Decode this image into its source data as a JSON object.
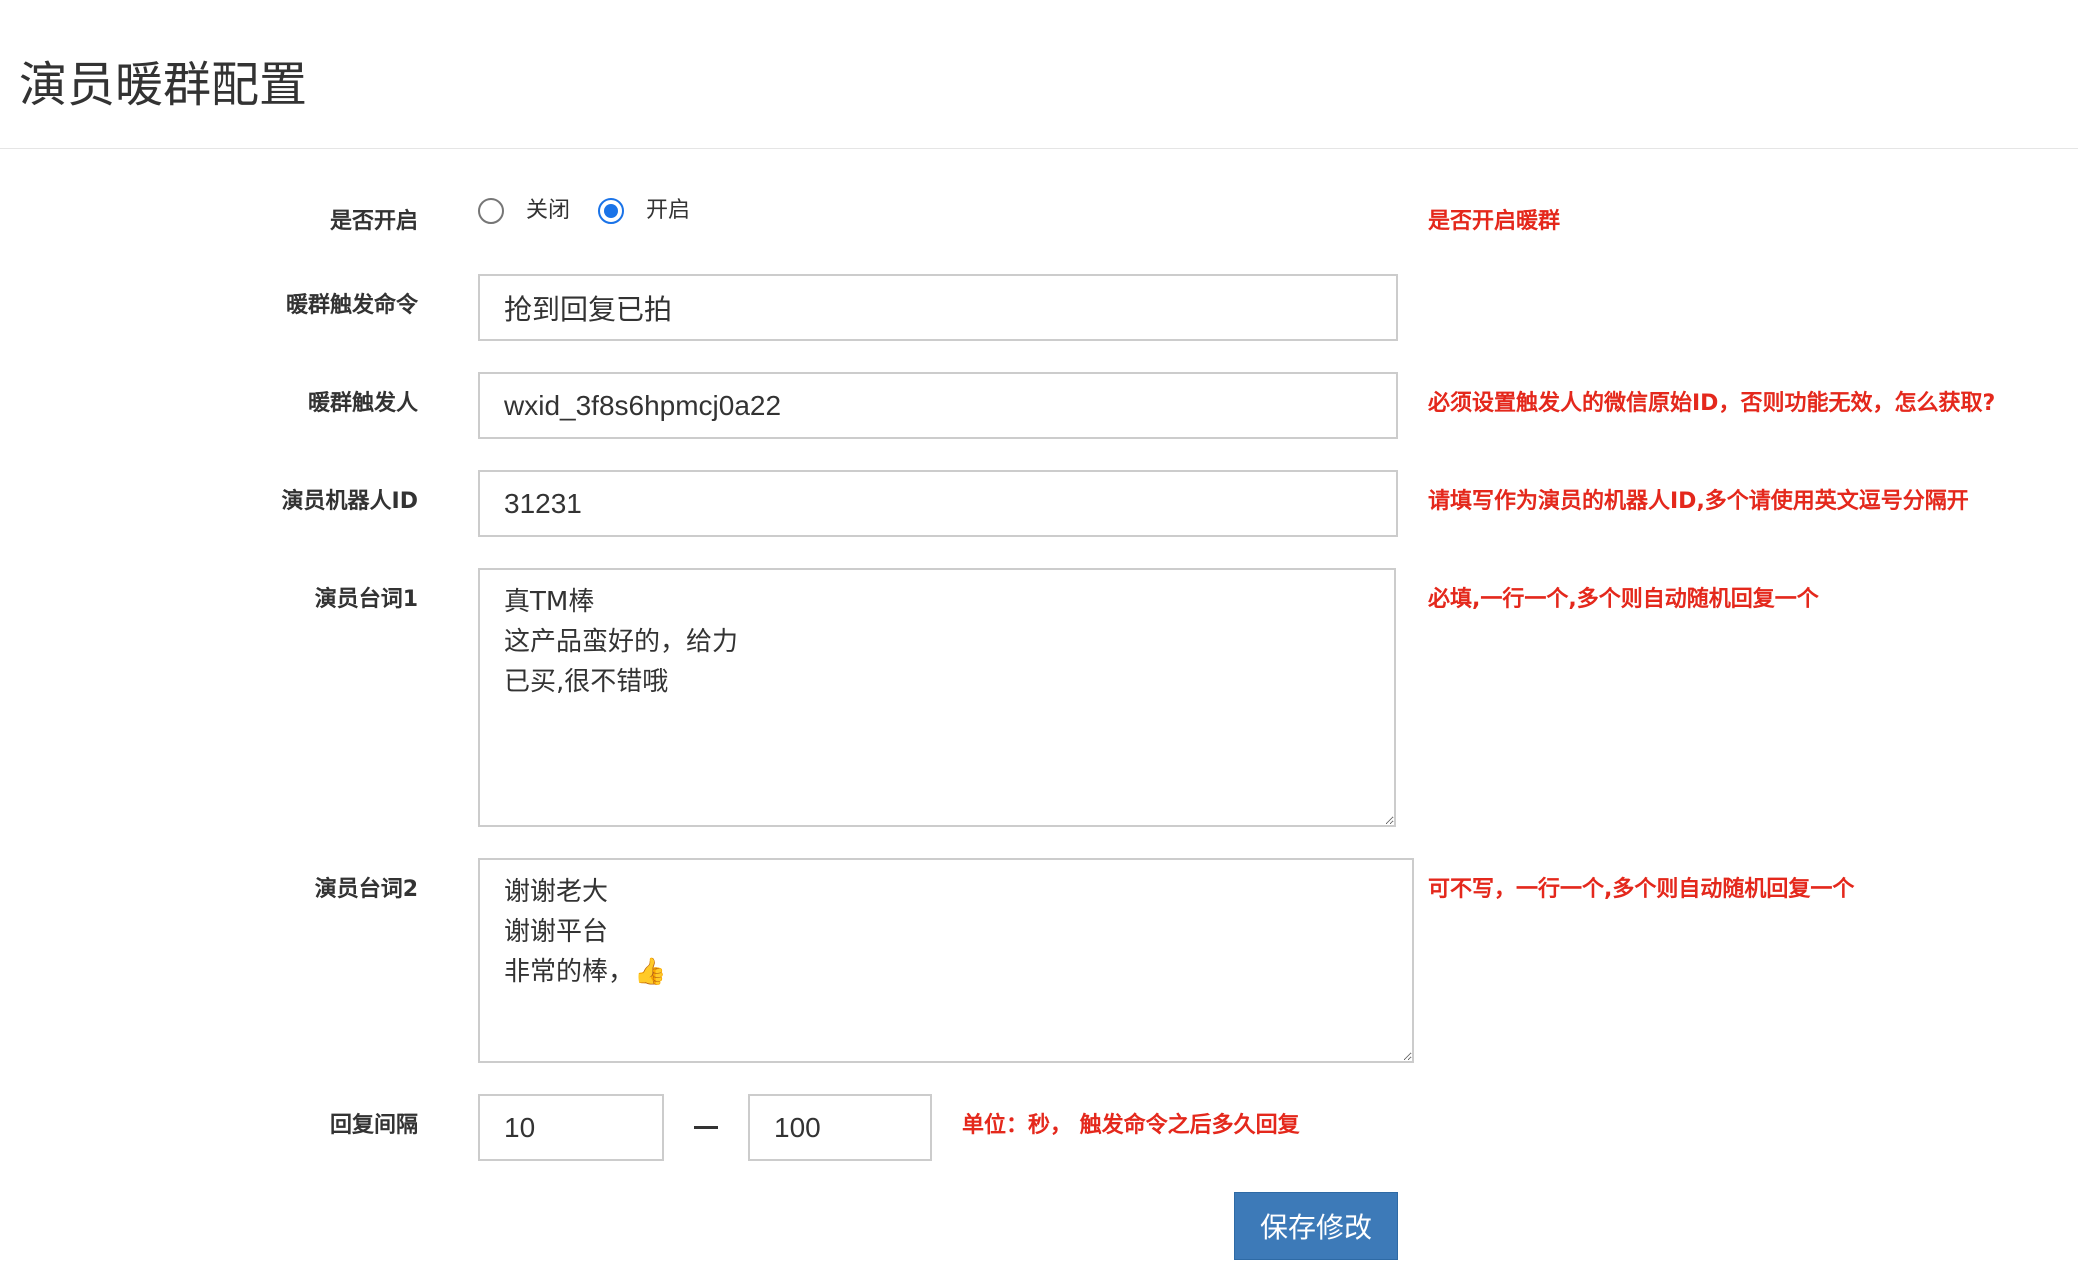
{
  "page": {
    "title": "演员暖群配置"
  },
  "form": {
    "enable": {
      "label": "是否开启",
      "options": [
        {
          "label": "关闭",
          "checked": false
        },
        {
          "label": "开启",
          "checked": true
        }
      ],
      "hint": "是否开启暖群"
    },
    "trigger_command": {
      "label": "暖群触发命令",
      "value": "抢到回复已拍"
    },
    "trigger_user": {
      "label": "暖群触发人",
      "value": "wxid_3f8s6hpmcj0a22",
      "hint": "必须设置触发人的微信原始ID，否则功能无效，怎么获取?"
    },
    "robot_id": {
      "label": "演员机器人ID",
      "value": "31231",
      "hint": "请填写作为演员的机器人ID,多个请使用英文逗号分隔开"
    },
    "lines1": {
      "label": "演员台词1",
      "value": "真TM棒\n这产品蛮好的，给力\n已买,很不错哦",
      "hint": "必填,一行一个,多个则自动随机回复一个"
    },
    "lines2": {
      "label": "演员台词2",
      "value": "谢谢老大\n谢谢平台\n非常的棒，👍",
      "hint": "可不写，一行一个,多个则自动随机回复一个"
    },
    "reply_interval": {
      "label": "回复间隔",
      "min": "10",
      "max": "100",
      "hint": "单位：秒， 触发命令之后多久回复"
    },
    "save_label": "保存修改"
  },
  "colors": {
    "hint": "#e4281c",
    "primary_button": "#3d7ab8",
    "radio_checked": "#1a73e8"
  }
}
